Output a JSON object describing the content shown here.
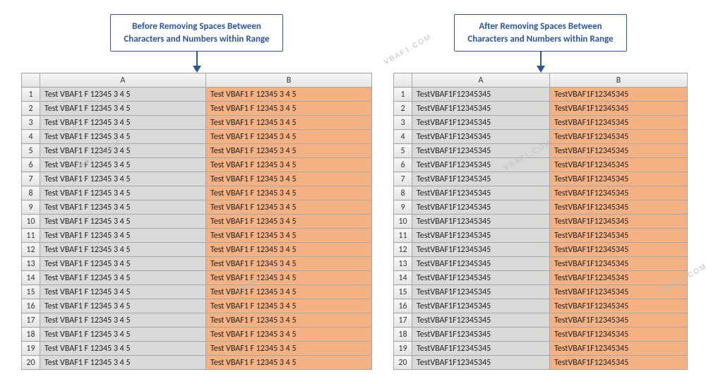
{
  "watermark": "VBAF1.COM",
  "before": {
    "title_line1": "Before Removing Spaces Between",
    "title_line2": "Characters and Numbers within Range",
    "columns": [
      "A",
      "B"
    ],
    "row_count": 20,
    "cell_value_A": "Test    VBAF1    F    12345    3  4  5",
    "cell_value_B": "Test    VBAF1    F    12345    3  4  5"
  },
  "after": {
    "title_line1": "After Removing Spaces Between",
    "title_line2": "Characters and Numbers within Range",
    "columns": [
      "A",
      "B"
    ],
    "row_count": 20,
    "cell_value_A": "TestVBAF1F12345345",
    "cell_value_B": "TestVBAF1F12345345"
  },
  "chart_data": {
    "type": "table",
    "description": "Two Excel-style ranges showing cell contents before and after removing spaces",
    "before_value": "Test    VBAF1    F    12345    3  4  5",
    "after_value": "TestVBAF1F12345345",
    "rows": 20,
    "columns": [
      "A",
      "B"
    ]
  }
}
